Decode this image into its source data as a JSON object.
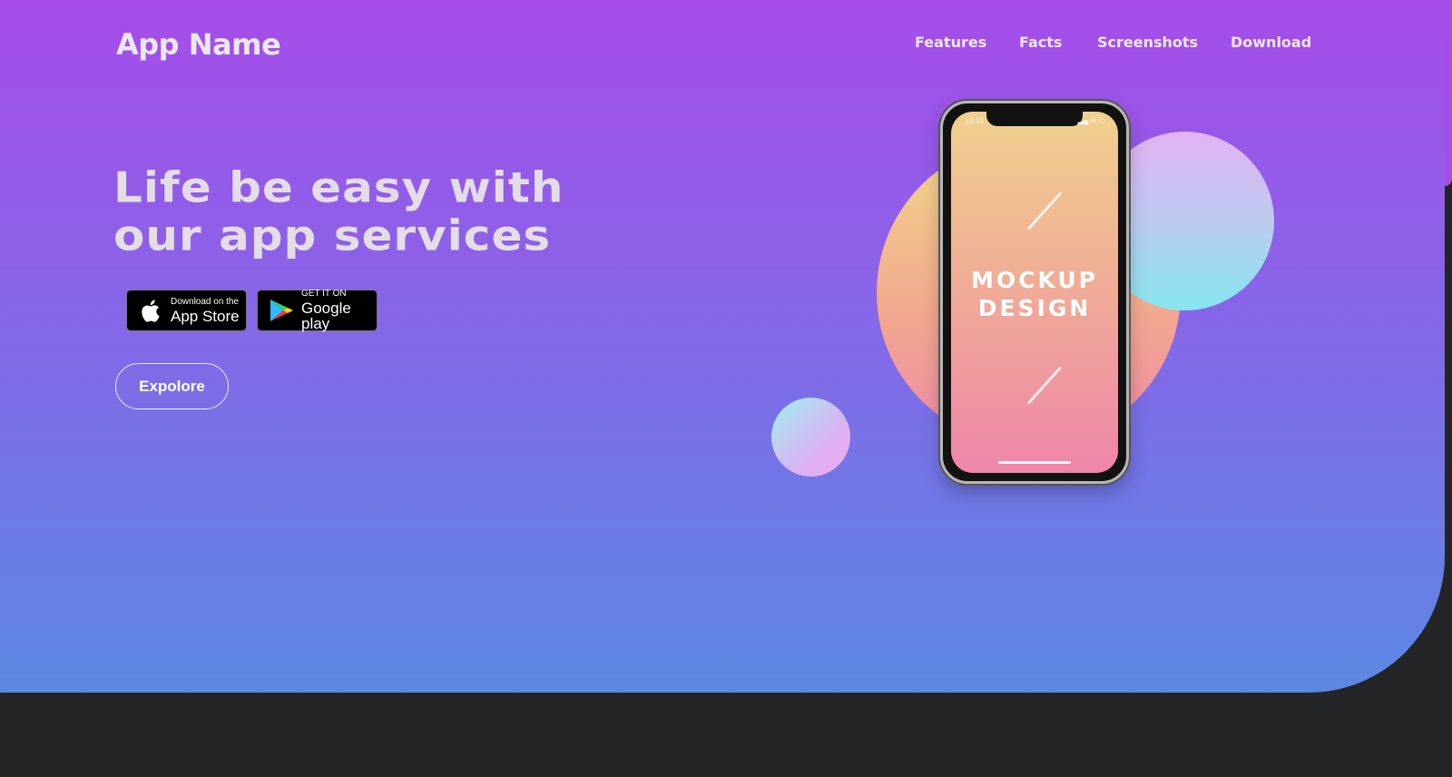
{
  "brand": {
    "name": "App Name"
  },
  "nav": {
    "items": [
      {
        "label": "Features"
      },
      {
        "label": "Facts"
      },
      {
        "label": "Screenshots"
      },
      {
        "label": "Download"
      }
    ]
  },
  "hero": {
    "headline_line1": "Life be easy with",
    "headline_line2": "our app services",
    "explore_label": "Expolore"
  },
  "badges": {
    "apple": {
      "small": "Download on the",
      "big": "App Store",
      "icon": "apple-icon"
    },
    "google": {
      "small": "GET IT ON",
      "big": "Google play",
      "icon": "google-play-icon"
    }
  },
  "phone": {
    "status_time": "14:10",
    "status_icons": "▂▄ ≋ ▭",
    "screen_line1": "MOCKUP",
    "screen_line2": "DESIGN"
  },
  "colors": {
    "gradient_top": "#a64ce9",
    "gradient_bottom": "#5b89e3",
    "footer_bg": "#232527",
    "text_light": "#ece7ee"
  }
}
